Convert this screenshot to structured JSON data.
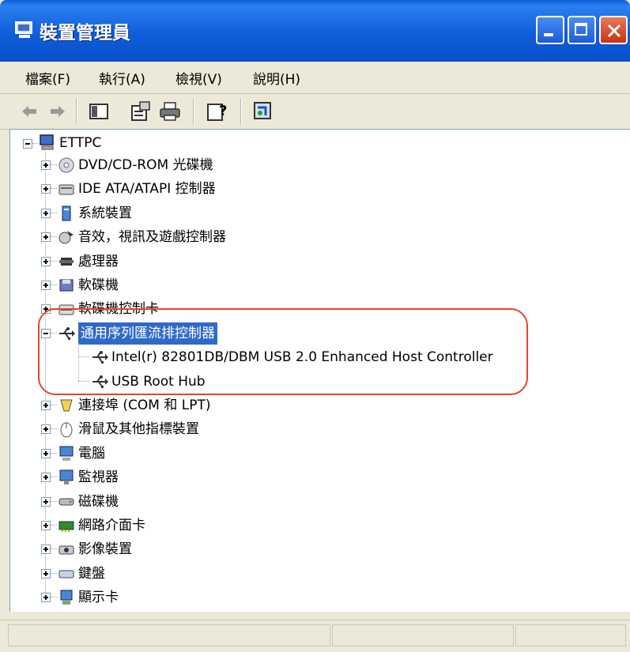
{
  "window": {
    "title": "裝置管理員"
  },
  "menu": [
    {
      "label": "檔案(F)"
    },
    {
      "label": "執行(A)"
    },
    {
      "label": "檢視(V)"
    },
    {
      "label": "說明(H)"
    }
  ],
  "toolbar": {
    "buttons": [
      "back-arrow-icon",
      "forward-arrow-icon",
      "show-hide-tree-icon",
      "properties-icon",
      "print-icon",
      "help-icon",
      "scan-hardware-icon"
    ]
  },
  "tree": {
    "root": "ETTPC",
    "items": [
      {
        "label": "DVD/CD-ROM 光碟機",
        "icon": "cdrom-icon",
        "expanded": false
      },
      {
        "label": "IDE ATA/ATAPI 控制器",
        "icon": "ide-controller-icon",
        "expanded": false
      },
      {
        "label": "系統裝置",
        "icon": "system-device-icon",
        "expanded": false
      },
      {
        "label": "音效，視訊及遊戲控制器",
        "icon": "sound-icon",
        "expanded": false
      },
      {
        "label": "處理器",
        "icon": "processor-icon",
        "expanded": false
      },
      {
        "label": "軟碟機",
        "icon": "floppy-icon",
        "expanded": false
      },
      {
        "label": "軟碟機控制卡",
        "icon": "floppy-controller-icon",
        "expanded": false
      },
      {
        "label": "通用序列匯流排控制器",
        "icon": "usb-icon",
        "expanded": true,
        "selected": true,
        "children": [
          {
            "label": "Intel(r) 82801DB/DBM USB 2.0 Enhanced Host Controller",
            "icon": "usb-icon"
          },
          {
            "label": "USB Root Hub",
            "icon": "usb-icon"
          }
        ]
      },
      {
        "label": "連接埠 (COM 和 LPT)",
        "icon": "port-icon",
        "expanded": false
      },
      {
        "label": "滑鼠及其他指標裝置",
        "icon": "mouse-icon",
        "expanded": false
      },
      {
        "label": "電腦",
        "icon": "computer-icon",
        "expanded": false
      },
      {
        "label": "監視器",
        "icon": "monitor-icon",
        "expanded": false
      },
      {
        "label": "磁碟機",
        "icon": "disk-drive-icon",
        "expanded": false
      },
      {
        "label": "網路介面卡",
        "icon": "network-adapter-icon",
        "expanded": false
      },
      {
        "label": "影像裝置",
        "icon": "imaging-device-icon",
        "expanded": false
      },
      {
        "label": "鍵盤",
        "icon": "keyboard-icon",
        "expanded": false
      },
      {
        "label": "顯示卡",
        "icon": "display-adapter-icon",
        "expanded": false
      }
    ]
  },
  "colors": {
    "titlebar": "#0A5FD8",
    "selection": "#316AC5",
    "highlight_ring": "#E2452E"
  }
}
